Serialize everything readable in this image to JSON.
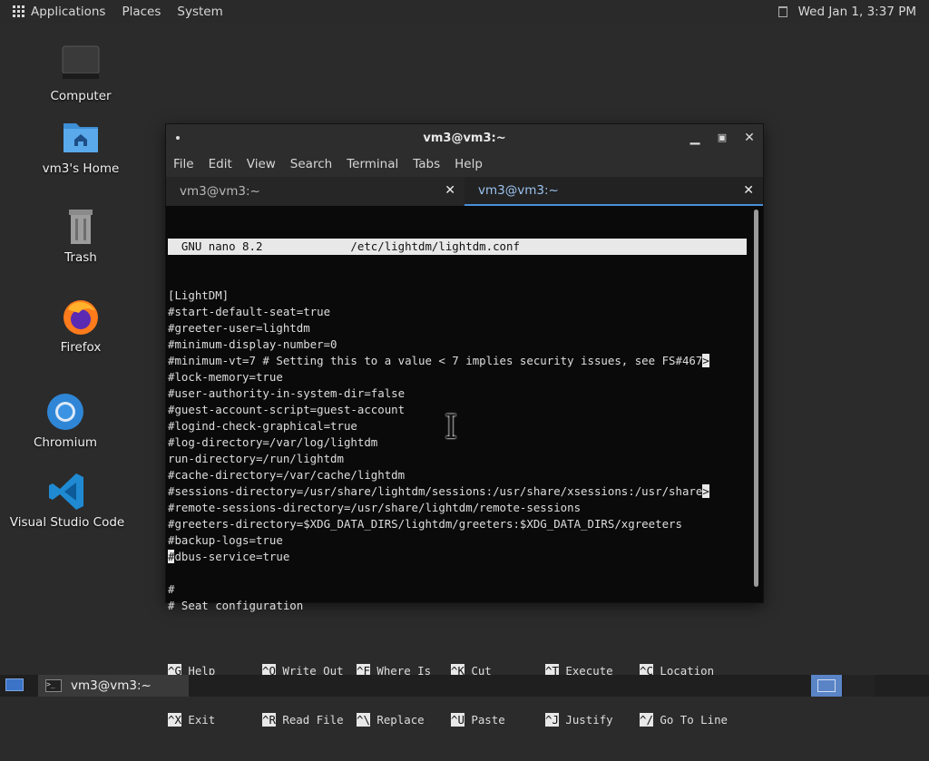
{
  "top_panel": {
    "menus": [
      "Applications",
      "Places",
      "System"
    ],
    "clock": "Wed Jan 1, 3:37 PM"
  },
  "desktop_icons": [
    {
      "label": "Computer",
      "icon": "computer-icon"
    },
    {
      "label": "vm3's Home",
      "icon": "home-folder-icon"
    },
    {
      "label": "Trash",
      "icon": "trash-icon"
    },
    {
      "label": "Firefox",
      "icon": "firefox-icon"
    },
    {
      "label": "Chromium",
      "icon": "chromium-icon"
    },
    {
      "label": "Visual Studio Code",
      "icon": "vscode-icon"
    }
  ],
  "window": {
    "title": "vm3@vm3:~",
    "menu": [
      "File",
      "Edit",
      "View",
      "Search",
      "Terminal",
      "Tabs",
      "Help"
    ],
    "tabs": [
      {
        "label": "vm3@vm3:~",
        "active": false
      },
      {
        "label": "vm3@vm3:~",
        "active": true
      }
    ]
  },
  "nano": {
    "header": "  GNU nano 8.2             /etc/lightdm/lightdm.conf",
    "lines": [
      "[LightDM]",
      "#start-default-seat=true",
      "#greeter-user=lightdm",
      "#minimum-display-number=0",
      "#minimum-vt=7 # Setting this to a value < 7 implies security issues, see FS#467",
      "#lock-memory=true",
      "#user-authority-in-system-dir=false",
      "#guest-account-script=guest-account",
      "#logind-check-graphical=true",
      "#log-directory=/var/log/lightdm",
      "run-directory=/run/lightdm",
      "#cache-directory=/var/cache/lightdm",
      "#sessions-directory=/usr/share/lightdm/sessions:/usr/share/xsessions:/usr/share",
      "#remote-sessions-directory=/usr/share/lightdm/remote-sessions",
      "#greeters-directory=$XDG_DATA_DIRS/lightdm/greeters:$XDG_DATA_DIRS/xgreeters",
      "#backup-logs=true",
      "#dbus-service=true",
      "",
      "#",
      "# Seat configuration",
      ""
    ],
    "truncation_marker": ">",
    "shortcuts_row1": [
      {
        "key": "^G",
        "label": "Help"
      },
      {
        "key": "^O",
        "label": "Write Out"
      },
      {
        "key": "^F",
        "label": "Where Is"
      },
      {
        "key": "^K",
        "label": "Cut"
      },
      {
        "key": "^T",
        "label": "Execute"
      },
      {
        "key": "^C",
        "label": "Location"
      }
    ],
    "shortcuts_row2": [
      {
        "key": "^X",
        "label": "Exit"
      },
      {
        "key": "^R",
        "label": "Read File"
      },
      {
        "key": "^\\",
        "label": "Replace"
      },
      {
        "key": "^U",
        "label": "Paste"
      },
      {
        "key": "^J",
        "label": "Justify"
      },
      {
        "key": "^/",
        "label": "Go To Line"
      }
    ]
  },
  "taskbar": {
    "task_label": "vm3@vm3:~",
    "task_icon": ">_"
  },
  "colors": {
    "desktop": "#2b2b2b",
    "active_tab_underline": "#4a90d9",
    "workspace_active": "#5a84c6"
  }
}
